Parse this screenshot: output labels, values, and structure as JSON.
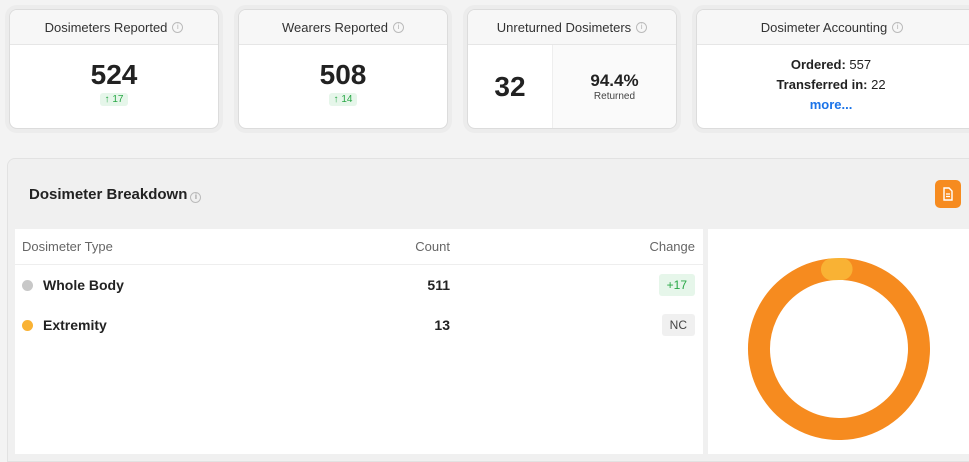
{
  "cards": {
    "dosimeters": {
      "title": "Dosimeters Reported",
      "value": "524",
      "delta": "17"
    },
    "wearers": {
      "title": "Wearers Reported",
      "value": "508",
      "delta": "14"
    },
    "unreturned": {
      "title": "Unreturned Dosimeters",
      "value": "32",
      "percent": "94.4%",
      "percent_label": "Returned"
    },
    "accounting": {
      "title": "Dosimeter Accounting",
      "ordered_label": "Ordered:",
      "ordered_value": "557",
      "transferred_label": "Transferred in:",
      "transferred_value": "22",
      "more_label": "more..."
    }
  },
  "breakdown": {
    "title": "Dosimeter Breakdown",
    "columns": {
      "type": "Dosimeter Type",
      "count": "Count",
      "change": "Change"
    },
    "rows": [
      {
        "type": "Whole Body",
        "count": "511",
        "change": "+17",
        "color": "#c8c8c8"
      },
      {
        "type": "Extremity",
        "count": "13",
        "change": "NC",
        "color": "#f9b234"
      }
    ]
  },
  "chart_data": {
    "type": "pie",
    "categories": [
      "Whole Body",
      "Extremity"
    ],
    "values": [
      511,
      13
    ],
    "colors": [
      "#f68b1f",
      "#f9b234"
    ],
    "title": ""
  },
  "colors": {
    "accent": "#f68b1f",
    "green": "#28a745",
    "link": "#1a73e8"
  },
  "icons": {
    "info": "info-icon",
    "pdf": "document-icon",
    "up": "arrow-up-icon"
  }
}
